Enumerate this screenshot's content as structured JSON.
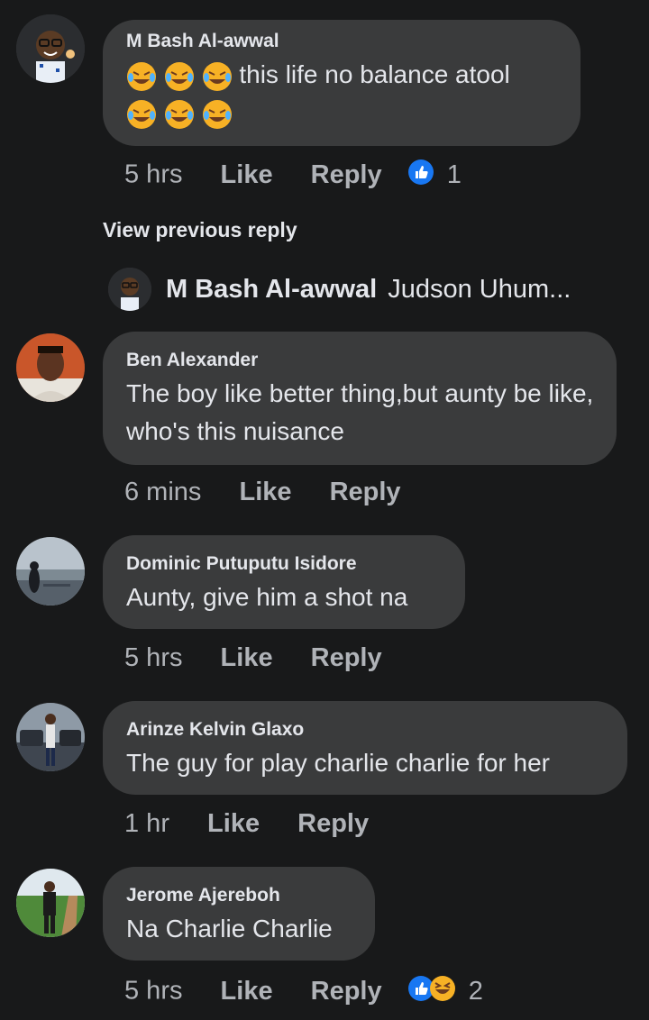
{
  "comments": [
    {
      "author": "M Bash Al-awwal",
      "text": "this life no balance atool",
      "time": "5 hrs",
      "like_label": "Like",
      "reply_label": "Reply",
      "reaction_count": "1",
      "emoji_count": 6,
      "avatar_icon": "bitmoji-avatar-icon"
    },
    {
      "author": "Ben Alexander",
      "text": "The boy like better thing,but aunty be like, who's this nuisance",
      "time": "6 mins",
      "like_label": "Like",
      "reply_label": "Reply",
      "avatar_icon": "profile-photo-icon"
    },
    {
      "author": "Dominic Putuputu Isidore",
      "text": "Aunty, give him a shot na",
      "time": "5 hrs",
      "like_label": "Like",
      "reply_label": "Reply",
      "avatar_icon": "profile-photo-icon"
    },
    {
      "author": "Arinze Kelvin Glaxo",
      "text": "The guy for play charlie charlie for her",
      "time": "1 hr",
      "like_label": "Like",
      "reply_label": "Reply",
      "avatar_icon": "profile-photo-icon"
    },
    {
      "author": "Jerome Ajereboh",
      "text": "Na Charlie Charlie",
      "time": "5 hrs",
      "like_label": "Like",
      "reply_label": "Reply",
      "reaction_count": "2",
      "avatar_icon": "profile-photo-icon"
    }
  ],
  "view_previous": "View previous reply",
  "reply_preview": {
    "author": "M Bash Al-awwal",
    "text": "Judson Uhum..."
  },
  "colors": {
    "background": "#18191a",
    "bubble": "#3a3b3c",
    "text": "#e4e6eb",
    "meta": "#b0b3b8",
    "like_blue": "#1877f2"
  }
}
